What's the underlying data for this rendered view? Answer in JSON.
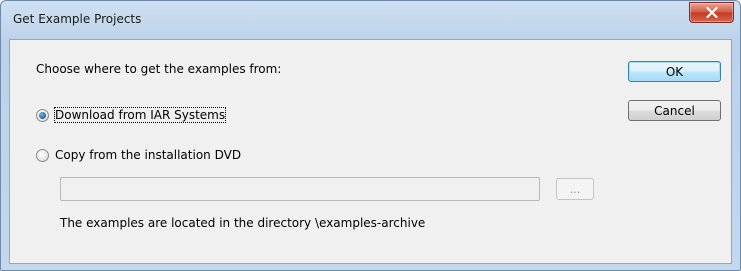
{
  "window": {
    "title": "Get Example Projects",
    "close_icon": "close-icon",
    "close_color": "#c7432b"
  },
  "prompt": "Choose where to get the examples from:",
  "buttons": {
    "ok": "OK",
    "cancel": "Cancel",
    "browse": "..."
  },
  "options": [
    {
      "label": "Download from IAR Systems",
      "selected": true
    },
    {
      "label": "Copy from the installation DVD",
      "selected": false
    }
  ],
  "path_field": {
    "value": "",
    "enabled": false
  },
  "info_text": "The examples are located in the directory \\examples-archive"
}
